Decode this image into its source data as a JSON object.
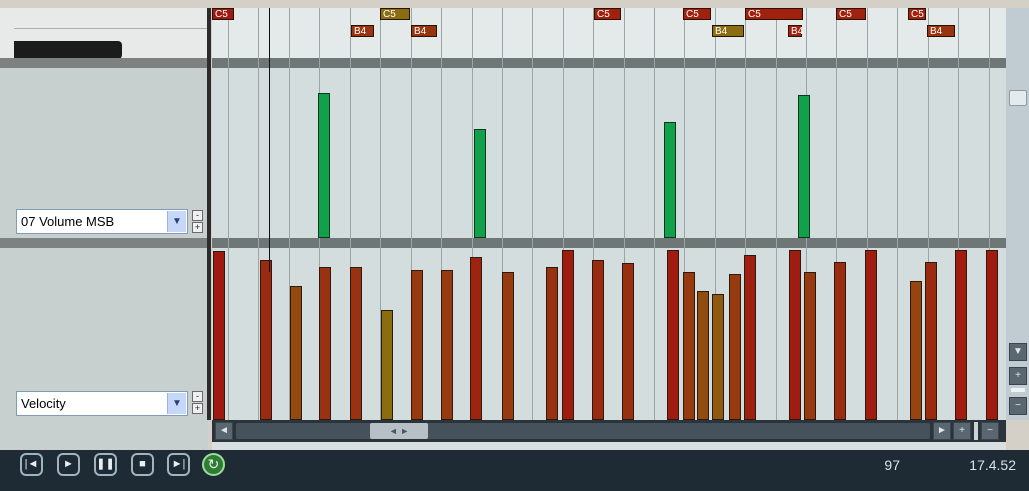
{
  "lanes": {
    "cc_lane": {
      "selected": "07 Volume MSB",
      "collapse": "-",
      "expand": "+"
    },
    "velocity_lane": {
      "selected": "Velocity",
      "collapse": "-",
      "expand": "+"
    }
  },
  "piano_roll": {
    "notes": [
      {
        "label": "C5",
        "color": "#9e1a10"
      },
      {
        "label": "C5",
        "color": "#8a6d10"
      },
      {
        "label": "B4",
        "color": "#9a3410"
      },
      {
        "label": "B4",
        "color": "#9a3410"
      },
      {
        "label": "C5",
        "color": "#a0220e"
      },
      {
        "label": "C5",
        "color": "#a0220e"
      },
      {
        "label": "B4",
        "color": "#8a6d10"
      },
      {
        "label": "C5",
        "color": "#a0220e"
      },
      {
        "label": "B4",
        "color": "#a0220e"
      },
      {
        "label": "C5",
        "color": "#a0220e"
      },
      {
        "label": "C5",
        "color": "#a0220e"
      },
      {
        "label": "B4",
        "color": "#9a3410"
      }
    ],
    "cc_values": [
      0.85,
      0.64,
      0.68,
      0.84
    ],
    "velocities": [
      {
        "v": 0.98,
        "color": "#9e1a10"
      },
      {
        "v": 0.93,
        "color": "#9a2a10"
      },
      {
        "v": 0.78,
        "color": "#924a0f"
      },
      {
        "v": 0.89,
        "color": "#983210"
      },
      {
        "v": 0.89,
        "color": "#983210"
      },
      {
        "v": 0.64,
        "color": "#8a6d10"
      },
      {
        "v": 0.87,
        "color": "#983a10"
      },
      {
        "v": 0.87,
        "color": "#983a10"
      },
      {
        "v": 0.95,
        "color": "#9e2410"
      },
      {
        "v": 0.86,
        "color": "#983a10"
      },
      {
        "v": 0.89,
        "color": "#983210"
      },
      {
        "v": 0.99,
        "color": "#a01c10"
      },
      {
        "v": 0.93,
        "color": "#9a2a10"
      },
      {
        "v": 0.91,
        "color": "#9a2e10"
      },
      {
        "v": 0.99,
        "color": "#a01c10"
      },
      {
        "v": 0.86,
        "color": "#983a10"
      },
      {
        "v": 0.75,
        "color": "#914c0f"
      },
      {
        "v": 0.73,
        "color": "#8f5a0f"
      },
      {
        "v": 0.85,
        "color": "#983a10"
      },
      {
        "v": 0.96,
        "color": "#9e2010"
      },
      {
        "v": 0.99,
        "color": "#a01c10"
      },
      {
        "v": 0.86,
        "color": "#983a10"
      },
      {
        "v": 0.92,
        "color": "#9a2a10"
      },
      {
        "v": 0.99,
        "color": "#a01c10"
      },
      {
        "v": 0.81,
        "color": "#964410"
      },
      {
        "v": 0.92,
        "color": "#9a2a10"
      },
      {
        "v": 0.99,
        "color": "#a01c10"
      },
      {
        "v": 0.99,
        "color": "#a01c10"
      }
    ]
  },
  "scrollbar": {
    "left_arrow": "◄",
    "right_arrow": "►",
    "thumb": "◄ ►",
    "zoom_in": "+",
    "zoom_out": "−"
  },
  "vscroll": {
    "down": "▼",
    "plus": "+",
    "minus": "−"
  },
  "transport": {
    "buttons": [
      {
        "icon": "skip-start-icon",
        "glyph": "|◄"
      },
      {
        "icon": "play-icon",
        "glyph": "►"
      },
      {
        "icon": "pause-icon",
        "glyph": "❚❚"
      },
      {
        "icon": "stop-icon",
        "glyph": "■"
      },
      {
        "icon": "skip-end-icon",
        "glyph": "►|"
      },
      {
        "icon": "loop-icon",
        "glyph": "↻"
      }
    ],
    "velocity_readout": "97",
    "position_readout": "17.4.52"
  },
  "colors": {
    "cc_bar": "#12a14a",
    "grid_bg": "#d7dfe0",
    "grid_line": "#9aa5a6",
    "transport_bg": "#1e2b35"
  }
}
